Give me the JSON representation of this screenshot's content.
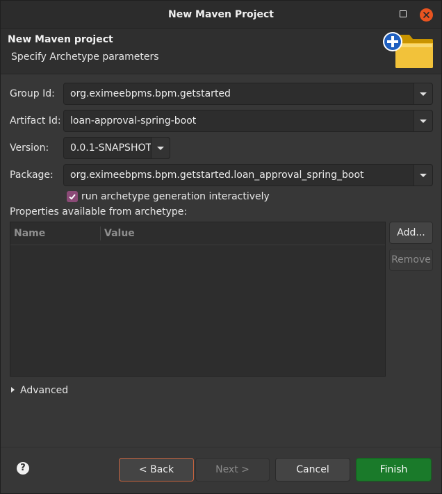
{
  "window": {
    "title": "New Maven Project"
  },
  "header": {
    "title": "New Maven project",
    "subtitle": "Specify Archetype parameters",
    "icon": "new-folder-icon"
  },
  "form": {
    "group_id": {
      "label": "Group Id:",
      "value": "org.eximeebpms.bpm.getstarted"
    },
    "artifact_id": {
      "label": "Artifact Id:",
      "value": "loan-approval-spring-boot"
    },
    "version": {
      "label": "Version:",
      "value": "0.0.1-SNAPSHOT"
    },
    "package": {
      "label": "Package:",
      "value": "org.eximeebpms.bpm.getstarted.loan_approval_spring_boot"
    },
    "interactive": {
      "label": "run archetype generation interactively",
      "checked": true
    }
  },
  "properties": {
    "label": "Properties available from archetype:",
    "columns": [
      "Name",
      "Value"
    ],
    "rows": [],
    "add_label": "Add...",
    "remove_label": "Remove"
  },
  "advanced": {
    "label": "Advanced"
  },
  "footer": {
    "help": "?",
    "back_label": "< Back",
    "next_label": "Next >",
    "cancel_label": "Cancel",
    "finish_label": "Finish"
  },
  "colors": {
    "accent_close": "#e95420",
    "checkbox": "#8b4a77",
    "finish": "#1a7a2a",
    "focus_border": "#c8633e"
  }
}
